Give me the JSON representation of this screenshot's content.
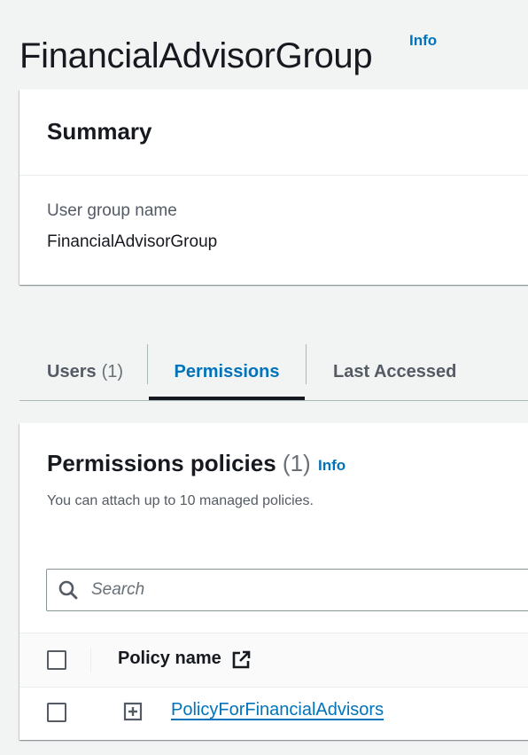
{
  "header": {
    "title": "FinancialAdvisorGroup",
    "info_label": "Info"
  },
  "summary": {
    "title": "Summary",
    "field_label": "User group name",
    "field_value": "FinancialAdvisorGroup"
  },
  "tabs": [
    {
      "label": "Users",
      "count": "(1)"
    },
    {
      "label": "Permissions",
      "selected": true
    },
    {
      "label": "Last Accessed"
    }
  ],
  "permissions": {
    "title": "Permissions policies",
    "count": "(1)",
    "info_label": "Info",
    "description": "You can attach up to 10 managed policies.",
    "search_placeholder": "Search",
    "column_header": "Policy name",
    "rows": [
      {
        "policy_name": "PolicyForFinancialAdvisors"
      }
    ]
  },
  "colors": {
    "link": "#0073bb",
    "text": "#16191f",
    "secondary": "#545b64",
    "background": "#f2f3f3"
  },
  "icons": [
    "search-icon",
    "external-link-icon",
    "expand-plus-icon"
  ]
}
